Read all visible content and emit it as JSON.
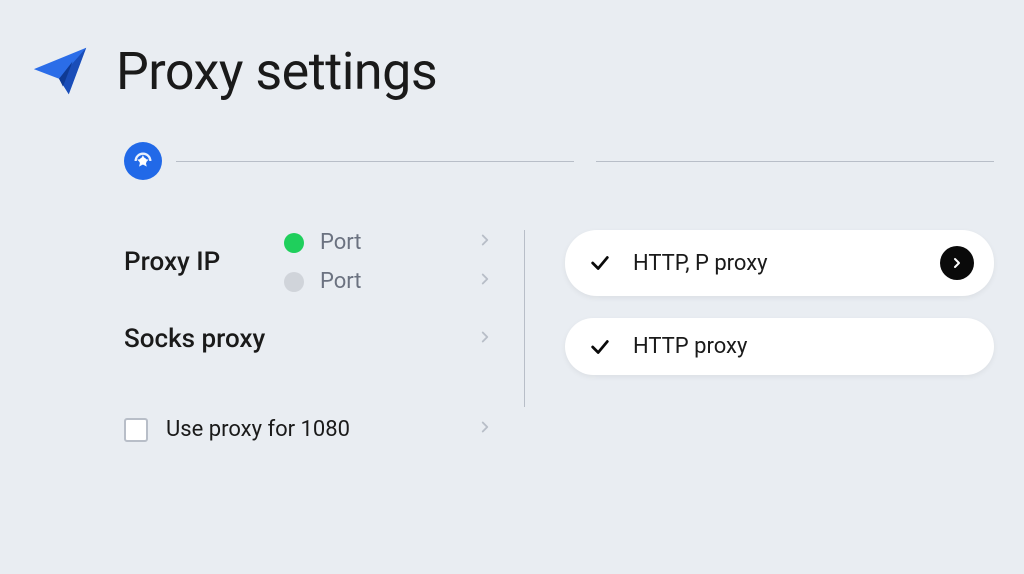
{
  "header": {
    "title": "Proxy settings"
  },
  "proxy_ip": {
    "label": "Proxy IP",
    "ports": [
      {
        "label": "Port",
        "status": "green"
      },
      {
        "label": "Port",
        "status": "gray"
      }
    ]
  },
  "socks": {
    "label": "Socks proxy"
  },
  "use_proxy": {
    "label": "Use proxy for 1080"
  },
  "proxies": [
    {
      "label": "HTTP, P proxy",
      "action": true
    },
    {
      "label": "HTTP proxy",
      "action": false
    }
  ]
}
